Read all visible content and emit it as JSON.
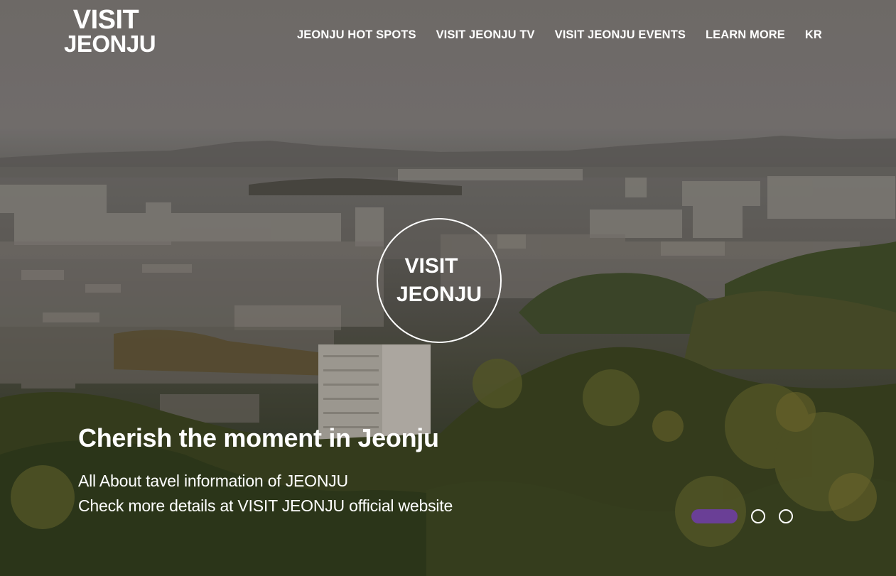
{
  "logo": {
    "line1": "VISIT",
    "line2": "JEONJU"
  },
  "nav": {
    "items": [
      {
        "label": "JEONJU HOT SPOTS"
      },
      {
        "label": "VISIT JEONJU TV"
      },
      {
        "label": "VISIT JEONJU EVENTS"
      },
      {
        "label": "LEARN MORE"
      },
      {
        "label": "KR"
      }
    ]
  },
  "badge": {
    "line1": "VISIT",
    "line2": "JEONJU"
  },
  "hero": {
    "headline": "Cherish the moment in Jeonju",
    "subline1": "All About tavel information of JEONJU",
    "subline2": "Check more details at VISIT JEONJU official website"
  },
  "pager": {
    "total": 3,
    "active_index": 0,
    "active_color": "#6a3f96"
  }
}
